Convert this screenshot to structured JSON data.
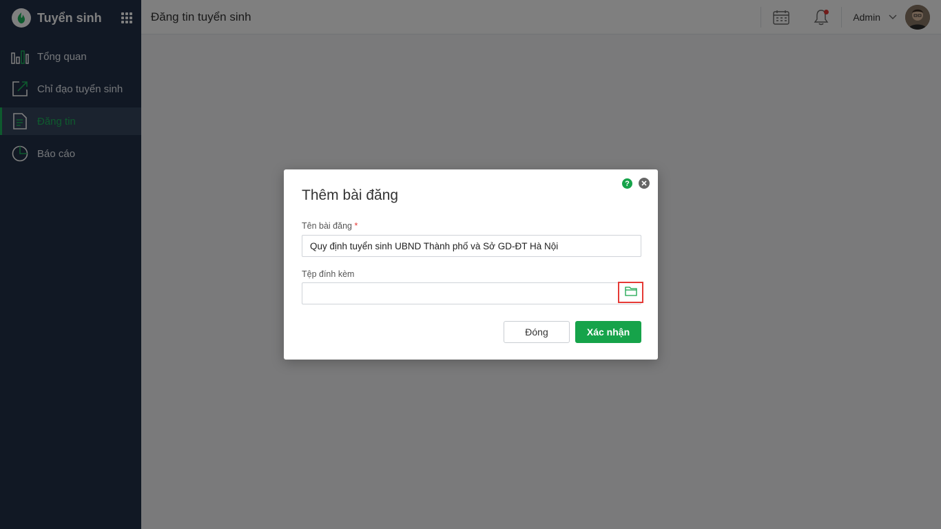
{
  "sidebar": {
    "brand": "Tuyển sinh",
    "items": [
      {
        "label": "Tổng quan",
        "icon": "bar-chart-icon"
      },
      {
        "label": "Chỉ đạo tuyển sinh",
        "icon": "edit-arrow-icon"
      },
      {
        "label": "Đăng tin",
        "icon": "document-icon",
        "active": true
      },
      {
        "label": "Báo cáo",
        "icon": "pie-chart-icon"
      }
    ]
  },
  "header": {
    "title": "Đăng tin tuyển sinh",
    "user": "Admin"
  },
  "modal": {
    "title": "Thêm bài đăng",
    "help": "?",
    "post_name_label": "Tên bài đăng",
    "required_mark": "*",
    "post_name_value": "Quy định tuyển sinh UBND Thành phố và Sở GD-ĐT Hà Nội",
    "attachment_label": "Tệp đính kèm",
    "attachment_value": "",
    "close_label": "Đóng",
    "confirm_label": "Xác nhận"
  },
  "colors": {
    "sidebar_bg": "#233149",
    "accent": "#16a34a",
    "highlight": "#e53935"
  }
}
